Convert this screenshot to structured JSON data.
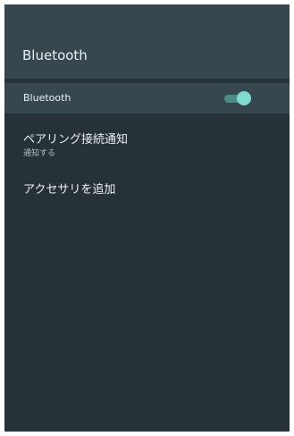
{
  "header": {
    "title": "Bluetooth"
  },
  "bluetooth_row": {
    "label": "Bluetooth",
    "toggle_on": true
  },
  "items": [
    {
      "title": "ペアリング接続通知",
      "subtitle": "通知する"
    },
    {
      "title": "アクセサリを追加"
    }
  ],
  "colors": {
    "background": "#263238",
    "header": "#37474f",
    "toggle_thumb": "#7fdbcf",
    "toggle_track": "#4f8b86"
  }
}
